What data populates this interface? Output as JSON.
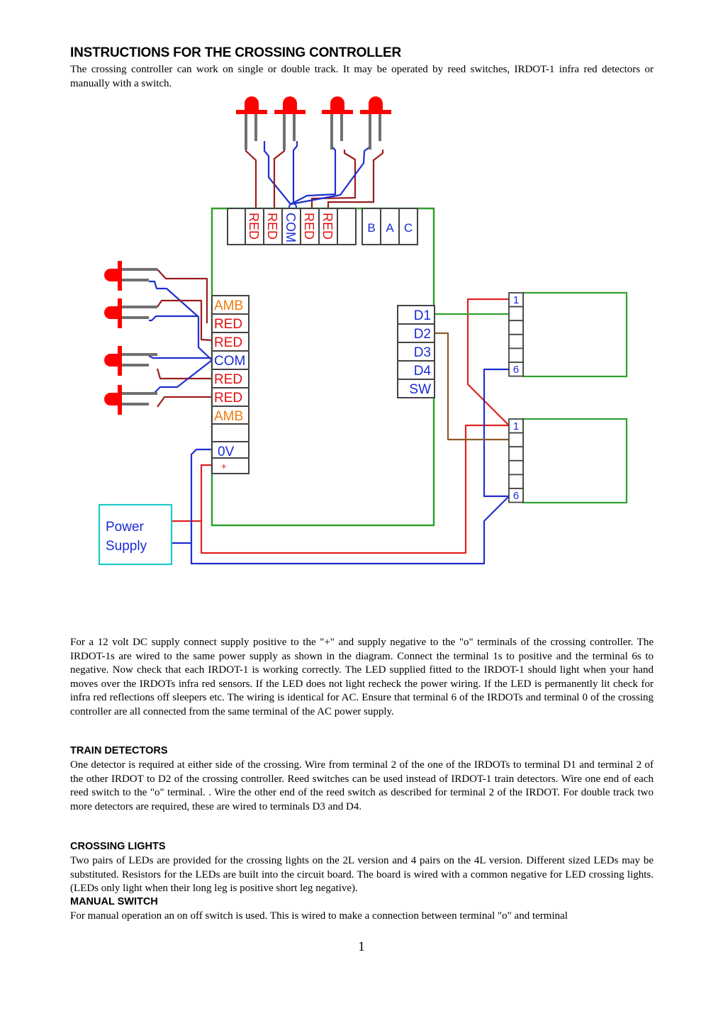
{
  "document": {
    "title": "INSTRUCTIONS FOR THE CROSSING CONTROLLER",
    "intro": "The crossing controller can work on single or double track. It may be operated by reed switches, IRDOT-1 infra red detectors or manually with a switch.",
    "power_paragraph": "For a 12 volt DC supply connect supply positive to the \"+\" and supply negative to the \"o\" terminals of the crossing controller. The IRDOT-1s are wired to the same power supply as shown in the diagram.  Connect the terminal 1s to positive and the terminal 6s to negative.  Now check that each IRDOT-1 is working correctly.  The LED supplied fitted to the IRDOT-1 should light when your hand moves over the IRDOTs infra red sensors.  If the LED does not light recheck the power wiring.  If the LED is permanently lit check for infra red reflections off sleepers etc. The wiring is identical for AC. Ensure that terminal 6 of the IRDOTs and terminal 0 of the crossing controller are all connected from the same terminal of the AC power supply.",
    "sections": [
      {
        "heading": "TRAIN DETECTORS",
        "text": "One detector is required at either side of the crossing. Wire from terminal 2 of the one of the IRDOTs to terminal D1 and terminal 2 of the other IRDOT to D2 of the crossing controller. Reed switches can be used instead of IRDOT-1 train detectors.  Wire one end of each reed switch to the \"o\" terminal. .  Wire the other end of the reed switch as described for terminal 2 of the IRDOT. For double track two more detectors are required, these are wired to terminals D3 and D4."
      },
      {
        "heading": "CROSSING LIGHTS",
        "text": "Two pairs of LEDs are provided for the crossing lights on the 2L version and 4 pairs on the 4L version. Different sized LEDs may be substituted. Resistors for the LEDs are built into the circuit board. The board is wired with a common negative for LED crossing lights.  (LEDs only light when their long leg is positive short leg negative)."
      },
      {
        "heading": "MANUAL SWITCH",
        "text": "For manual operation an on off switch is used. This is wired to make a connection between terminal \"o\" and terminal"
      }
    ],
    "page_number": "1"
  },
  "diagram": {
    "top_terminals": [
      "",
      "RED",
      "RED",
      "COM",
      "RED",
      "RED",
      ""
    ],
    "top_right_terminals": [
      "B",
      "A",
      "C"
    ],
    "left_terminals": [
      "AMB",
      "RED",
      "RED",
      "COM",
      "RED",
      "RED",
      "AMB",
      "",
      "0V",
      "+"
    ],
    "detector_terminals": [
      "D1",
      "D2",
      "D3",
      "D4",
      "SW"
    ],
    "irdot_terminals": [
      "1",
      "",
      "",
      "",
      "",
      "6"
    ],
    "power_supply_label_line1": "Power",
    "power_supply_label_line2": "Supply",
    "colors": {
      "board_outline": "#2ea02e",
      "positive_wire": "#e02020",
      "negative_wire": "#1f2fd0",
      "led_wire": "#9b1c1c",
      "d2_wire": "#8b5a2b",
      "led_body": "#ff0000",
      "led_leg": "#707070",
      "label_red": "#e01010",
      "label_blue": "#1a2ad8",
      "label_amber": "#f07a10",
      "power_supply_outline": "#20c8c8"
    }
  }
}
